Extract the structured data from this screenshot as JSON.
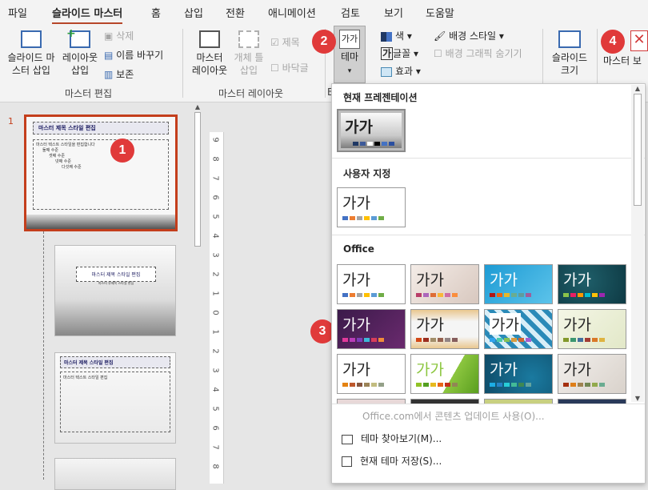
{
  "tabs": [
    "파일",
    "슬라이드 마스터",
    "홈",
    "삽입",
    "전환",
    "애니메이션",
    "검토",
    "보기",
    "도움말"
  ],
  "ribbon": {
    "insert_master": "슬라이드 마\n스터 삽입",
    "insert_layout": "레이아웃\n삽입",
    "delete": "삭제",
    "rename": "이름 바꾸기",
    "preserve": "보존",
    "master_layout": "마스터\n레이아웃",
    "insert_placeholder": "개체 틀\n삽입",
    "title_check": "제목",
    "footer_check": "바닥글",
    "themes": "테마",
    "colors": "색",
    "fonts": "글꼴",
    "effects": "효과",
    "background_styles": "배경 스타일",
    "hide_background": "배경 그래픽 숨기기",
    "slide_size": "슬라이드\n크기",
    "close_master": "마스터 보",
    "group_master_edit": "마스터 편집",
    "group_master_layout": "마스터 레이아웃",
    "group_e": "E"
  },
  "thumbs": {
    "slide_num": "1",
    "master_title": "마스터 제목 스타일 편집",
    "master_text": "마스터 텍스트 스타일을 편집합니다",
    "level2": "둘째 수준",
    "level3": "셋째 수준",
    "level4": "넷째 수준",
    "level5": "다섯째 수준",
    "layout2_title": "마스터 제목 스타일 편집",
    "layout2_sub": "마스터 부제목 스타일 편집",
    "layout3_title": "마스터 제목 스타일 편집",
    "layout3_text": "마스터 텍스트 스타일 편집"
  },
  "ruler_labels": [
    "9",
    "8",
    "7",
    "6",
    "5",
    "4",
    "3",
    "2",
    "1",
    "0",
    "1",
    "2",
    "3",
    "4",
    "5",
    "6",
    "7",
    "8"
  ],
  "panel": {
    "current_label": "현재 프레젠테이션",
    "custom_label": "사용자 지정",
    "office_label": "Office",
    "sample": "가가",
    "enable_updates": "Office.com에서 콘텐츠 업데이트 사용(O)...",
    "browse": "테마 찾아보기(M)...",
    "save": "현재 테마 저장(S)..."
  },
  "badges": [
    "1",
    "2",
    "3",
    "4"
  ],
  "colors": {
    "accent": "#b7472a",
    "badge": "#e03a3a",
    "selected": "#c43e1c"
  }
}
